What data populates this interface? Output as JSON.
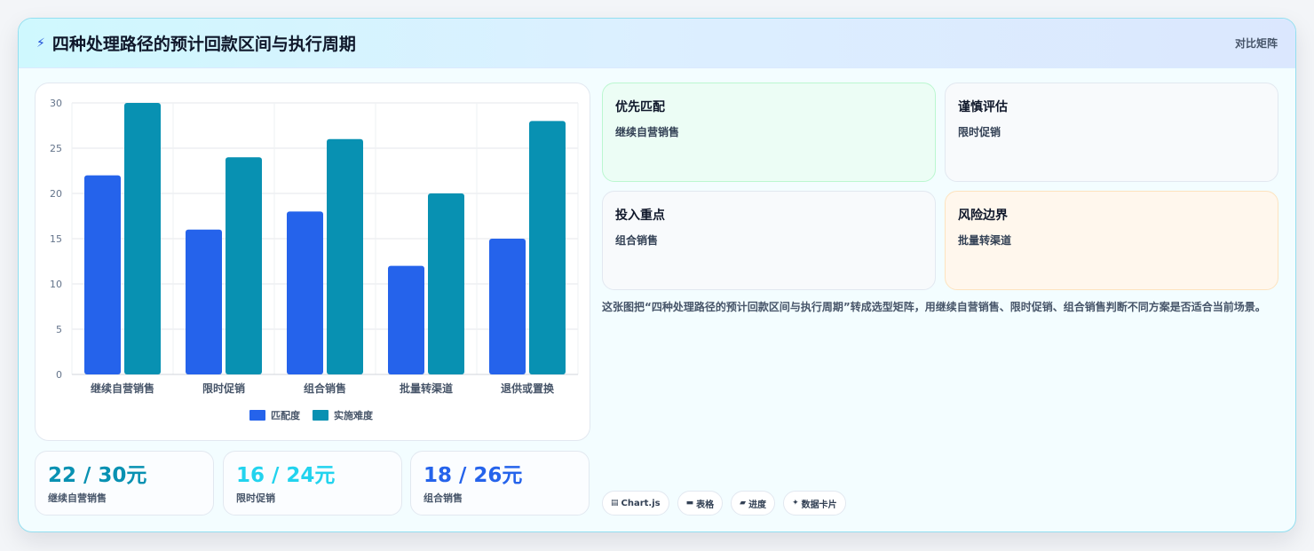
{
  "header": {
    "icon": "bolt-icon",
    "title": "四种处理路径的预计回款区间与执行周期",
    "tag": "对比矩阵"
  },
  "chart_data": {
    "type": "bar",
    "categories": [
      "继续自营销售",
      "限时促销",
      "组合销售",
      "批量转渠道",
      "退供或置换"
    ],
    "series": [
      {
        "name": "匹配度",
        "values": [
          22,
          16,
          18,
          12,
          15
        ],
        "color": "#2563eb"
      },
      {
        "name": "实施难度",
        "values": [
          30,
          24,
          26,
          20,
          28
        ],
        "color": "#0891b2"
      }
    ],
    "yticks": [
      "0",
      "5",
      "10",
      "15",
      "20",
      "25",
      "30"
    ],
    "ylim": [
      0,
      30
    ],
    "legend": "bottom",
    "grid": true
  },
  "stats": [
    {
      "value": "22 / 30元",
      "label": "继续自营销售",
      "color": "#0891b2"
    },
    {
      "value": "16 / 24元",
      "label": "限时促销",
      "color": "#22d3ee"
    },
    {
      "value": "18 / 26元",
      "label": "组合销售",
      "color": "#2563eb"
    }
  ],
  "tiles": [
    {
      "title": "优先匹配",
      "sub": "继续自营销售",
      "bg": "#ecfdf5",
      "border": "#bbf7d0"
    },
    {
      "title": "谨慎评估",
      "sub": "限时促销",
      "bg": "#f8fafc",
      "border": "#e2e8f0"
    },
    {
      "title": "投入重点",
      "sub": "组合销售",
      "bg": "#f8fafc",
      "border": "#e2e8f0"
    },
    {
      "title": "风险边界",
      "sub": "批量转渠道",
      "bg": "#fff7ed",
      "border": "#fde3bf"
    }
  ],
  "description": "这张图把“四种处理路径的预计回款区间与执行周期”转成选型矩阵，用继续自营销售、限时促销、组合销售判断不同方案是否适合当前场景。",
  "tags": [
    {
      "icon": "chart-icon",
      "glyph": "▤",
      "label": "Chart.js"
    },
    {
      "icon": "table-icon",
      "glyph": "▬",
      "label": "表格"
    },
    {
      "icon": "progress-icon",
      "glyph": "▰",
      "label": "进度"
    },
    {
      "icon": "sparkle-icon",
      "glyph": "✦",
      "label": "数据卡片"
    }
  ]
}
